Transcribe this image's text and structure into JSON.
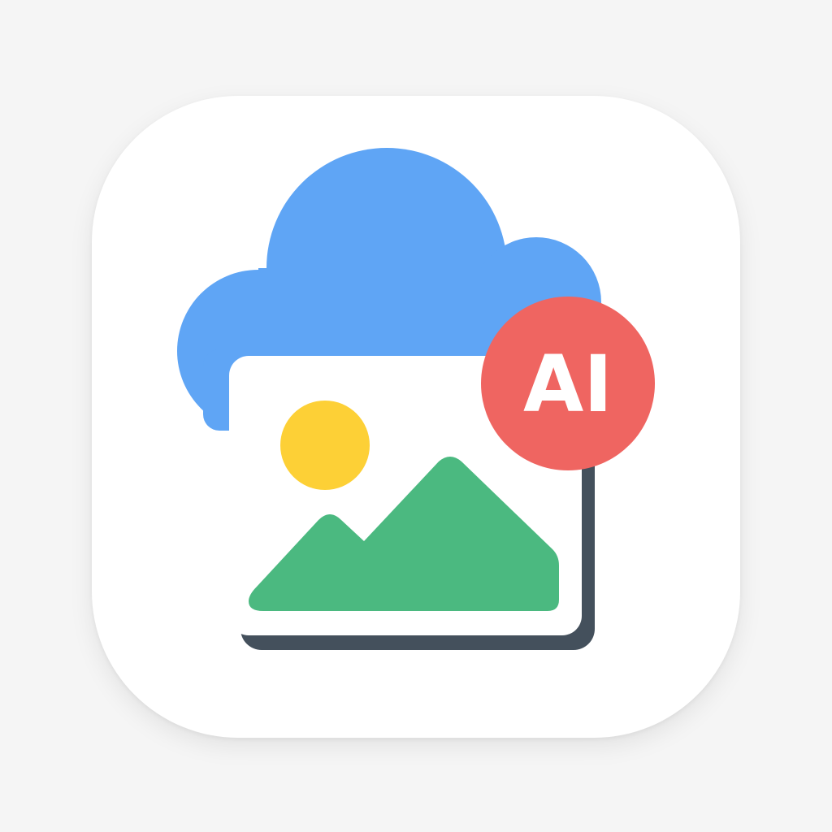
{
  "app_icon": {
    "badge_text": "AI",
    "icons": {
      "cloud": "cloud-icon",
      "image": "image-icon",
      "sun": "sun-icon",
      "mountains": "mountains-icon",
      "badge": "ai-badge-icon"
    },
    "colors": {
      "background": "#f5f5f5",
      "tile": "#ffffff",
      "cloud": "#5fa5f5",
      "frame_shadow": "#44505c",
      "frame": "#ffffff",
      "sun": "#fdd036",
      "mountain": "#4bb980",
      "badge": "#ef6561",
      "badge_text": "#ffffff"
    }
  }
}
